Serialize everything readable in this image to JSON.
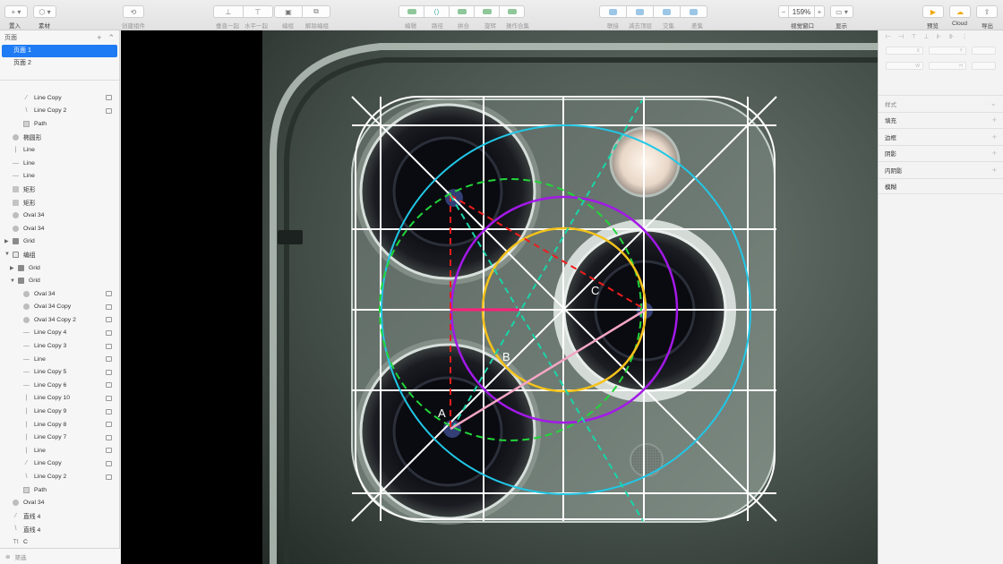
{
  "toolbar": {
    "insert_label": "置入",
    "material_label": "素材",
    "create_symbol_label": "创建组件",
    "align_labels": [
      "垂直一起",
      "水平一起"
    ],
    "group_label": "编组",
    "ungroup_label": "解除编组",
    "edit_labels": [
      "编辑",
      "路径",
      "拼合",
      "旋转",
      "操作合集"
    ],
    "bool_labels": [
      "联接",
      "减去顶层",
      "交集",
      "差集"
    ],
    "zoom_value": "159%",
    "zoom_minus": "−",
    "zoom_plus": "+",
    "zoom_label": "视觉窗口",
    "display_label": "显示",
    "preview_label": "预览",
    "cloud_label": "Cloud",
    "export_label": "导出"
  },
  "sidebar": {
    "pages_title": "页面",
    "pages": [
      "页面 1",
      "页面 2"
    ],
    "layers": [
      {
        "label": "Line Copy",
        "icon": "line-diag",
        "indent": 26,
        "link": true
      },
      {
        "label": "Line Copy 2",
        "icon": "line-diag2",
        "indent": 26,
        "link": true
      },
      {
        "label": "Path",
        "icon": "path",
        "indent": 26,
        "link": false
      },
      {
        "label": "椭圆形",
        "icon": "oval",
        "indent": 14,
        "link": false
      },
      {
        "label": "Line",
        "icon": "line-v",
        "indent": 14,
        "link": false
      },
      {
        "label": "Line",
        "icon": "line-h",
        "indent": 14,
        "link": false
      },
      {
        "label": "Line",
        "icon": "line-h",
        "indent": 14,
        "link": false
      },
      {
        "label": "矩形",
        "icon": "rect",
        "indent": 14,
        "link": false
      },
      {
        "label": "矩形",
        "icon": "rect",
        "indent": 14,
        "link": false
      },
      {
        "label": "Oval 34",
        "icon": "oval",
        "indent": 14,
        "link": false
      },
      {
        "label": "Oval 34",
        "icon": "oval",
        "indent": 14,
        "link": false
      },
      {
        "label": "Grid",
        "icon": "grid",
        "indent": 14,
        "link": false,
        "tri": "▶"
      },
      {
        "label": "编组",
        "icon": "folder",
        "indent": 14,
        "link": false,
        "tri": "▼"
      },
      {
        "label": "Grid",
        "icon": "grid",
        "indent": 20,
        "link": false,
        "tri": "▶"
      },
      {
        "label": "Grid",
        "icon": "grid",
        "indent": 20,
        "link": false,
        "tri": "▼"
      },
      {
        "label": "Oval 34",
        "icon": "oval",
        "indent": 26,
        "link": true
      },
      {
        "label": "Oval 34 Copy",
        "icon": "oval",
        "indent": 26,
        "link": true
      },
      {
        "label": "Oval 34 Copy 2",
        "icon": "oval",
        "indent": 26,
        "link": true
      },
      {
        "label": "Line Copy 4",
        "icon": "line-h",
        "indent": 26,
        "link": true
      },
      {
        "label": "Line Copy 3",
        "icon": "line-h",
        "indent": 26,
        "link": true
      },
      {
        "label": "Line",
        "icon": "line-h",
        "indent": 26,
        "link": true
      },
      {
        "label": "Line Copy 5",
        "icon": "line-h",
        "indent": 26,
        "link": true
      },
      {
        "label": "Line Copy 6",
        "icon": "line-h",
        "indent": 26,
        "link": true
      },
      {
        "label": "Line Copy 10",
        "icon": "line-v",
        "indent": 26,
        "link": true
      },
      {
        "label": "Line Copy 9",
        "icon": "line-v",
        "indent": 26,
        "link": true
      },
      {
        "label": "Line Copy 8",
        "icon": "line-v",
        "indent": 26,
        "link": true
      },
      {
        "label": "Line Copy 7",
        "icon": "line-v",
        "indent": 26,
        "link": true
      },
      {
        "label": "Line",
        "icon": "line-v",
        "indent": 26,
        "link": true
      },
      {
        "label": "Line Copy",
        "icon": "line-diag",
        "indent": 26,
        "link": true
      },
      {
        "label": "Line Copy 2",
        "icon": "line-diag2",
        "indent": 26,
        "link": true
      },
      {
        "label": "Path",
        "icon": "path",
        "indent": 26,
        "link": false
      },
      {
        "label": "Oval 34",
        "icon": "oval",
        "indent": 14,
        "link": false
      },
      {
        "label": "直线 4",
        "icon": "line-diag",
        "indent": 14,
        "link": false
      },
      {
        "label": "直线 4",
        "icon": "line-diag2",
        "indent": 14,
        "link": false
      },
      {
        "label": "C",
        "icon": "text",
        "indent": 14,
        "link": false
      }
    ],
    "filter_label": "筛选"
  },
  "canvas": {
    "labels": {
      "a": "A",
      "b": "B",
      "c": "C"
    },
    "colors": {
      "cyan": "#21c7e6",
      "purple": "#a319e8",
      "green": "#22d63a",
      "yellow": "#f4c21a",
      "red": "#f01c1c",
      "magenta": "#ff1f7a",
      "teal": "#19d4a8",
      "white": "#ffffff"
    }
  },
  "inspector": {
    "field_labels": [
      "X",
      "Y",
      "W",
      "H"
    ],
    "sections": [
      "样式",
      "填充",
      "边框",
      "阴影",
      "内阴影",
      "模糊"
    ]
  }
}
